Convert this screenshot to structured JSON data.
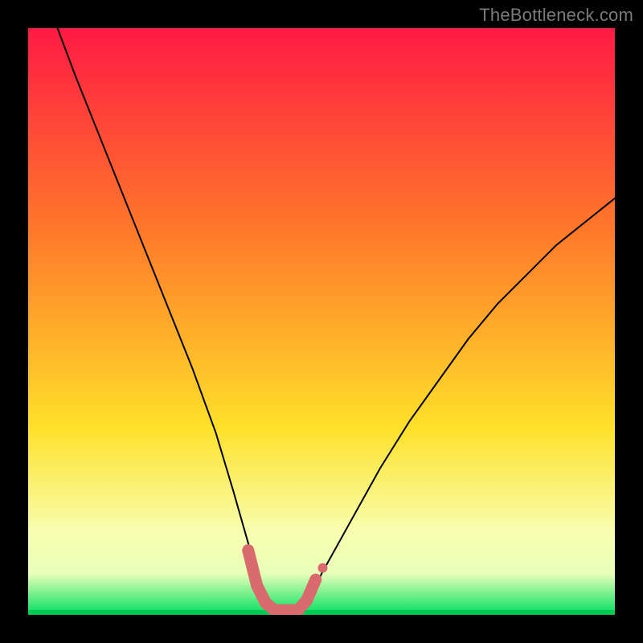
{
  "watermark": "TheBottleneck.com",
  "chart_data": {
    "type": "line",
    "title": "",
    "xlabel": "",
    "ylabel": "",
    "xlim": [
      0,
      100
    ],
    "ylim": [
      0,
      100
    ],
    "background_gradient": {
      "top": "#ff1a44",
      "mid1": "#ff7a2a",
      "mid2": "#ffe02a",
      "band": "#f7ffb0",
      "bottom": "#00e060"
    },
    "series": [
      {
        "name": "bottleneck-curve",
        "color": "#000000",
        "stroke_width": 2,
        "x": [
          5,
          8,
          12,
          16,
          20,
          24,
          28,
          32,
          35,
          37,
          39,
          40.5,
          42,
          46,
          48,
          50,
          55,
          60,
          65,
          70,
          75,
          80,
          85,
          90,
          95,
          100
        ],
        "y": [
          100,
          92,
          82,
          72,
          62,
          52,
          42,
          31,
          21,
          14,
          7,
          2.5,
          0.5,
          0.5,
          2.5,
          7,
          16,
          25,
          33,
          40,
          47,
          53,
          58,
          63,
          67,
          71
        ]
      }
    ],
    "highlight_segment": {
      "name": "optimal-range",
      "color": "#d96a6e",
      "stroke_width": 15,
      "x": [
        37.5,
        39,
        40.5,
        42,
        44,
        46,
        47.5,
        49
      ],
      "y": [
        11,
        5,
        2,
        0.8,
        0.8,
        0.8,
        2.5,
        6
      ]
    },
    "highlight_dot": {
      "x": 50.2,
      "y": 8,
      "r": 6,
      "color": "#d96a6e"
    }
  }
}
